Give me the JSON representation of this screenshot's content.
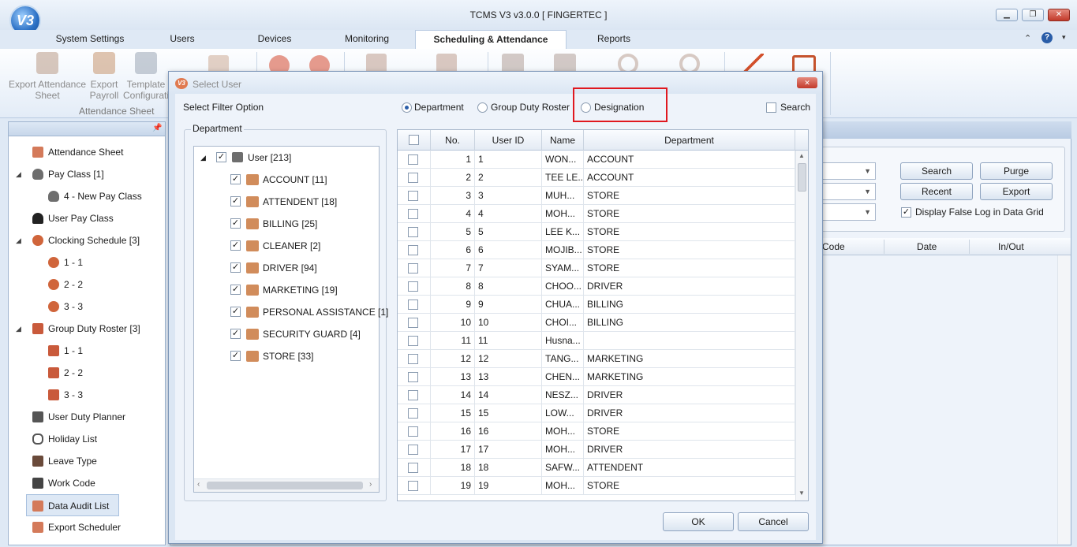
{
  "app": {
    "title": "TCMS V3 v3.0.0 [ FINGERTEC ]",
    "logo_text": "V3"
  },
  "tabs": [
    "System Settings",
    "Users",
    "Devices",
    "Monitoring",
    "Scheduling & Attendance",
    "Reports"
  ],
  "ribbon": {
    "export_attendance": "Export Attendance Sheet",
    "export_payroll": "Export Payroll",
    "template_config": "Template Configurati",
    "group_label": "Attendance Sheet"
  },
  "sidebar": {
    "items": [
      {
        "label": "Attendance Sheet"
      },
      {
        "label": "Pay Class [1]"
      },
      {
        "label": "4 - New Pay Class"
      },
      {
        "label": "User Pay Class"
      },
      {
        "label": "Clocking Schedule [3]"
      },
      {
        "label": "1 - 1"
      },
      {
        "label": "2 - 2"
      },
      {
        "label": "3 - 3"
      },
      {
        "label": "Group Duty Roster [3]"
      },
      {
        "label": "1 - 1"
      },
      {
        "label": "2 - 2"
      },
      {
        "label": "3 - 3"
      },
      {
        "label": "User Duty Planner"
      },
      {
        "label": "Holiday List"
      },
      {
        "label": "Leave Type"
      },
      {
        "label": "Work Code"
      },
      {
        "label": "Data Audit List"
      },
      {
        "label": "Export Scheduler"
      }
    ]
  },
  "right": {
    "search": "Search",
    "purge": "Purge",
    "recent": "Recent",
    "export": "Export",
    "display_false_log": "Display False Log in Data Grid",
    "col_code": "Code",
    "col_date": "Date",
    "col_inout": "In/Out"
  },
  "dialog": {
    "title": "Select User",
    "filter_label": "Select Filter Option",
    "opt_department": "Department",
    "opt_group_duty": "Group Duty Roster",
    "opt_designation": "Designation",
    "search": "Search",
    "dept_box_title": "Department",
    "root": "User [213]",
    "departments": [
      "ACCOUNT [11]",
      "ATTENDENT [18]",
      "BILLING [25]",
      "CLEANER [2]",
      "DRIVER [94]",
      "MARKETING [19]",
      "PERSONAL ASSISTANCE [1]",
      "SECURITY GUARD [4]",
      "STORE [33]"
    ],
    "columns": {
      "no": "No.",
      "user_id": "User ID",
      "name": "Name",
      "department": "Department"
    },
    "rows": [
      {
        "no": "1",
        "id": "1",
        "name": "WON...",
        "dept": "ACCOUNT"
      },
      {
        "no": "2",
        "id": "2",
        "name": "TEE LE...",
        "dept": "ACCOUNT"
      },
      {
        "no": "3",
        "id": "3",
        "name": "MUH...",
        "dept": "STORE"
      },
      {
        "no": "4",
        "id": "4",
        "name": "MOH...",
        "dept": "STORE"
      },
      {
        "no": "5",
        "id": "5",
        "name": "LEE K...",
        "dept": "STORE"
      },
      {
        "no": "6",
        "id": "6",
        "name": "MOJIB...",
        "dept": "STORE"
      },
      {
        "no": "7",
        "id": "7",
        "name": "SYAM...",
        "dept": "STORE"
      },
      {
        "no": "8",
        "id": "8",
        "name": "CHOO...",
        "dept": "DRIVER"
      },
      {
        "no": "9",
        "id": "9",
        "name": "CHUA...",
        "dept": "BILLING"
      },
      {
        "no": "10",
        "id": "10",
        "name": "CHOI...",
        "dept": "BILLING"
      },
      {
        "no": "11",
        "id": "11",
        "name": "Husna...",
        "dept": ""
      },
      {
        "no": "12",
        "id": "12",
        "name": "TANG...",
        "dept": "MARKETING"
      },
      {
        "no": "13",
        "id": "13",
        "name": "CHEN...",
        "dept": "MARKETING"
      },
      {
        "no": "14",
        "id": "14",
        "name": "NESZ...",
        "dept": "DRIVER"
      },
      {
        "no": "15",
        "id": "15",
        "name": "LOW...",
        "dept": "DRIVER"
      },
      {
        "no": "16",
        "id": "16",
        "name": "MOH...",
        "dept": "STORE"
      },
      {
        "no": "17",
        "id": "17",
        "name": "MOH...",
        "dept": "DRIVER"
      },
      {
        "no": "18",
        "id": "18",
        "name": "SAFW...",
        "dept": "ATTENDENT"
      },
      {
        "no": "19",
        "id": "19",
        "name": "MOH...",
        "dept": "STORE"
      }
    ],
    "ok": "OK",
    "cancel": "Cancel"
  }
}
